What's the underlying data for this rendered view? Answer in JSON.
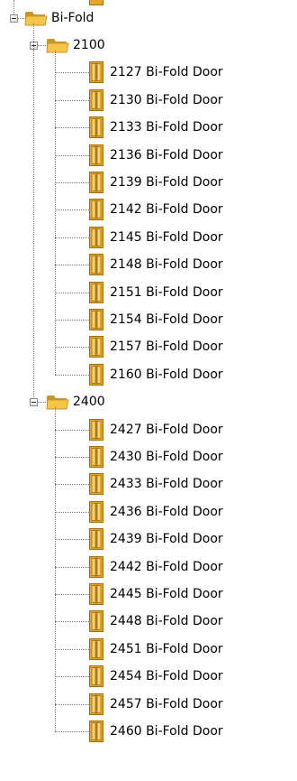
{
  "tree": {
    "root": {
      "label": "Bi-Fold",
      "icon": "folder-icon",
      "groups": [
        {
          "label": "2100",
          "icon": "folder-icon",
          "items": [
            "2127 Bi-Fold Door",
            "2130 Bi-Fold Door",
            "2133 Bi-Fold Door",
            "2136 Bi-Fold Door",
            "2139 Bi-Fold Door",
            "2142 Bi-Fold Door",
            "2145 Bi-Fold Door",
            "2148 Bi-Fold Door",
            "2151 Bi-Fold Door",
            "2154 Bi-Fold Door",
            "2157 Bi-Fold Door",
            "2160 Bi-Fold Door"
          ]
        },
        {
          "label": "2400",
          "icon": "folder-icon",
          "items": [
            "2427 Bi-Fold Door",
            "2430 Bi-Fold Door",
            "2433 Bi-Fold Door",
            "2436 Bi-Fold Door",
            "2439 Bi-Fold Door",
            "2442 Bi-Fold Door",
            "2445 Bi-Fold Door",
            "2448 Bi-Fold Door",
            "2451 Bi-Fold Door",
            "2454 Bi-Fold Door",
            "2457 Bi-Fold Door",
            "2460 Bi-Fold Door"
          ]
        }
      ]
    },
    "item_icon": "door-icon",
    "colors": {
      "folder": "#f6c54a",
      "folder_edge": "#c9962a",
      "door": "#e3a82a",
      "door_edge": "#a56f10",
      "door_panel": "#f5d27a"
    }
  }
}
